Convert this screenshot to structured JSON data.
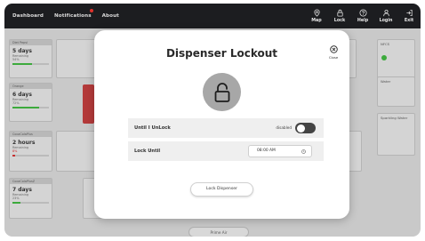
{
  "topbar": {
    "tabs": [
      {
        "label": "Dashboard"
      },
      {
        "label": "Notifications"
      },
      {
        "label": "About"
      }
    ],
    "icons": [
      {
        "label": "Map",
        "icon": "map-pin-icon"
      },
      {
        "label": "Lock",
        "icon": "lock-icon"
      },
      {
        "label": "Help",
        "icon": "help-icon"
      },
      {
        "label": "Login",
        "icon": "user-icon"
      },
      {
        "label": "Exit",
        "icon": "exit-icon"
      }
    ]
  },
  "background": {
    "cards": [
      {
        "head": "Diet Pepsi",
        "big": "5 days",
        "sub": "Remaining",
        "pct": "54%",
        "fill": 0.54,
        "color": "#3caa3c"
      },
      {
        "head": "Orange",
        "big": "6 days",
        "sub": "Remaining",
        "pct": "72%",
        "fill": 0.72,
        "color": "#3caa3c"
      },
      {
        "head": "CocaColaPlus",
        "big": "2 hours",
        "sub": "Remaining",
        "pct": "8%",
        "fill": 0.08,
        "color": "#c73030"
      },
      {
        "head": "CocaColaPlusZ",
        "big": "7 days",
        "sub": "Remaining",
        "pct": "23%",
        "fill": 0.23,
        "color": "#3caa3c"
      }
    ],
    "side_cards": [
      {
        "label": "NFCS"
      },
      {
        "label": "Water"
      },
      {
        "label": "Sparkling Water"
      }
    ],
    "bottom_button": "Prime Air"
  },
  "modal": {
    "title": "Dispenser Lockout",
    "close_label": "Close",
    "until_unlock_label": "Until I UnLock",
    "toggle_state": "disabled",
    "lock_until_label": "Lock Until",
    "lock_until_value": "08:00 AM",
    "lock_button": "Lock Dispenser"
  }
}
